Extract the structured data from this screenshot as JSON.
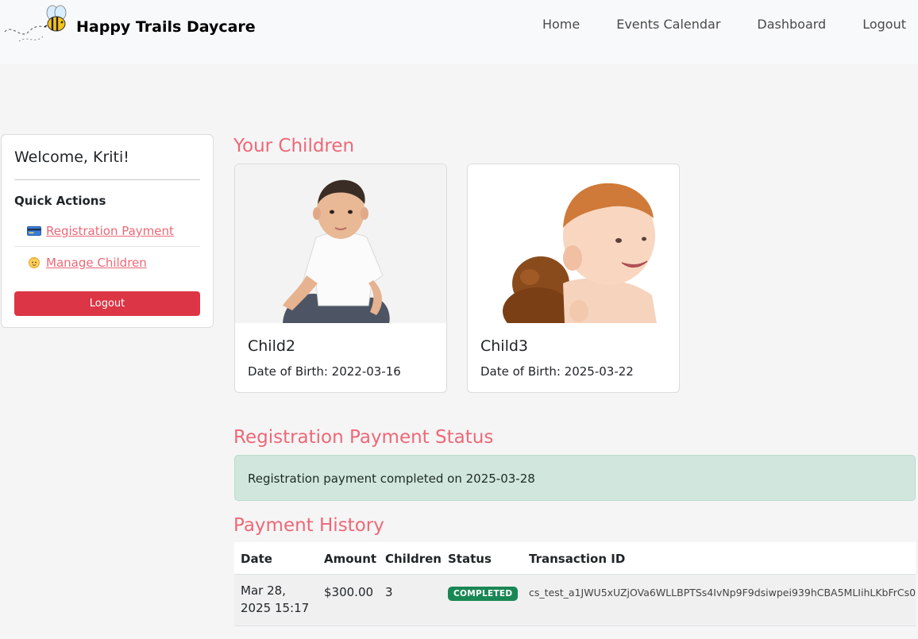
{
  "navbar": {
    "brand": "Happy Trails Daycare",
    "links": [
      "Home",
      "Events Calendar",
      "Dashboard",
      "Logout"
    ]
  },
  "sidebar": {
    "welcome": "Welcome, Kriti!",
    "quick_actions_title": "Quick Actions",
    "links": [
      {
        "icon": "credit-card-icon",
        "label": "Registration Payment"
      },
      {
        "icon": "baby-icon",
        "label": "Manage Children"
      }
    ],
    "logout_label": "Logout"
  },
  "children_section": {
    "title": "Your Children",
    "children": [
      {
        "name": "Child2",
        "dob": "Date of Birth: 2022-03-16"
      },
      {
        "name": "Child3",
        "dob": "Date of Birth: 2025-03-22"
      }
    ]
  },
  "payment_status": {
    "title": "Registration Payment Status",
    "message": "Registration payment completed on 2025-03-28"
  },
  "payment_history": {
    "title": "Payment History",
    "columns": [
      "Date",
      "Amount",
      "Children",
      "Status",
      "Transaction ID"
    ],
    "rows": [
      {
        "date": "Mar 28, 2025 15:17",
        "amount": "$300.00",
        "children": "3",
        "status": "COMPLETED",
        "transaction_id": "cs_test_a1JWU5xUZjOVa6WLLBPTSs4IvNp9F9dsiwpei939hCBA5MLIihLKbFrCs0"
      }
    ]
  },
  "colors": {
    "accent": "#ee6878",
    "danger": "#dc3545",
    "success_badge": "#198754",
    "alert_bg": "#d1e7dd"
  }
}
